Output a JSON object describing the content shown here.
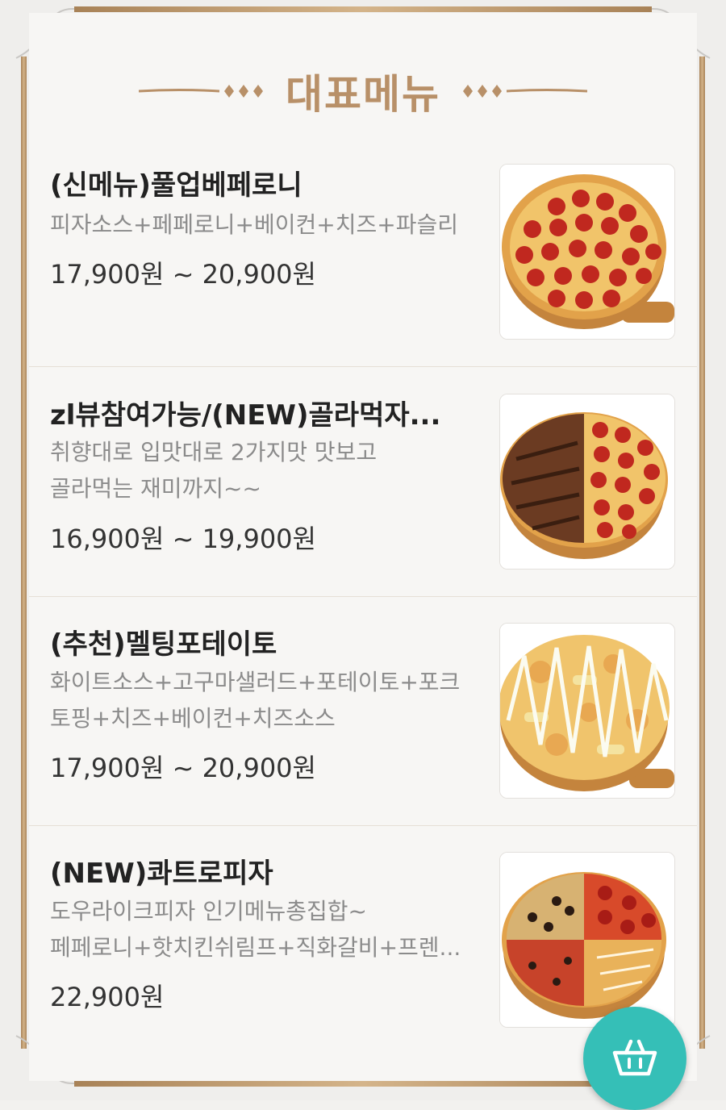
{
  "section": {
    "title": "대표메뉴"
  },
  "menu_items": [
    {
      "name": "(신메뉴)풀업베페로니",
      "description_lines": [
        "피자소스+페페로니+베이컨+치즈+파슬리"
      ],
      "price": "17,900원 ~ 20,900원",
      "image_icon": "pepperoni-pizza-image"
    },
    {
      "name": "zl뷰참여가능/(NEW)골라먹자...",
      "description_lines": [
        "취향대로 입맛대로 2가지맛 맛보고",
        "골라먹는 재미까지~~"
      ],
      "price": "16,900원 ~ 19,900원",
      "image_icon": "half-and-half-pizza-image"
    },
    {
      "name": "(추천)멜팅포테이토",
      "description_lines": [
        "화이트소스+고구마샐러드+포테이토+포크",
        "토핑+치즈+베이컨+치즈소스"
      ],
      "price": "17,900원 ~ 20,900원",
      "image_icon": "potato-pizza-image"
    },
    {
      "name": "(NEW)콰트로피자",
      "description_lines": [
        "도우라이크피자 인기메뉴총집합~",
        "페페로니+핫치킨쉬림프+직화갈비+프렌..."
      ],
      "price": "22,900원",
      "image_icon": "quattro-pizza-image"
    }
  ],
  "cart_button": {
    "icon": "shopping-basket-icon"
  },
  "colors": {
    "accent_gold": "#b89068",
    "cart_teal": "#35bfb7",
    "price_text": "#333333",
    "desc_text": "#8b8b8b"
  }
}
